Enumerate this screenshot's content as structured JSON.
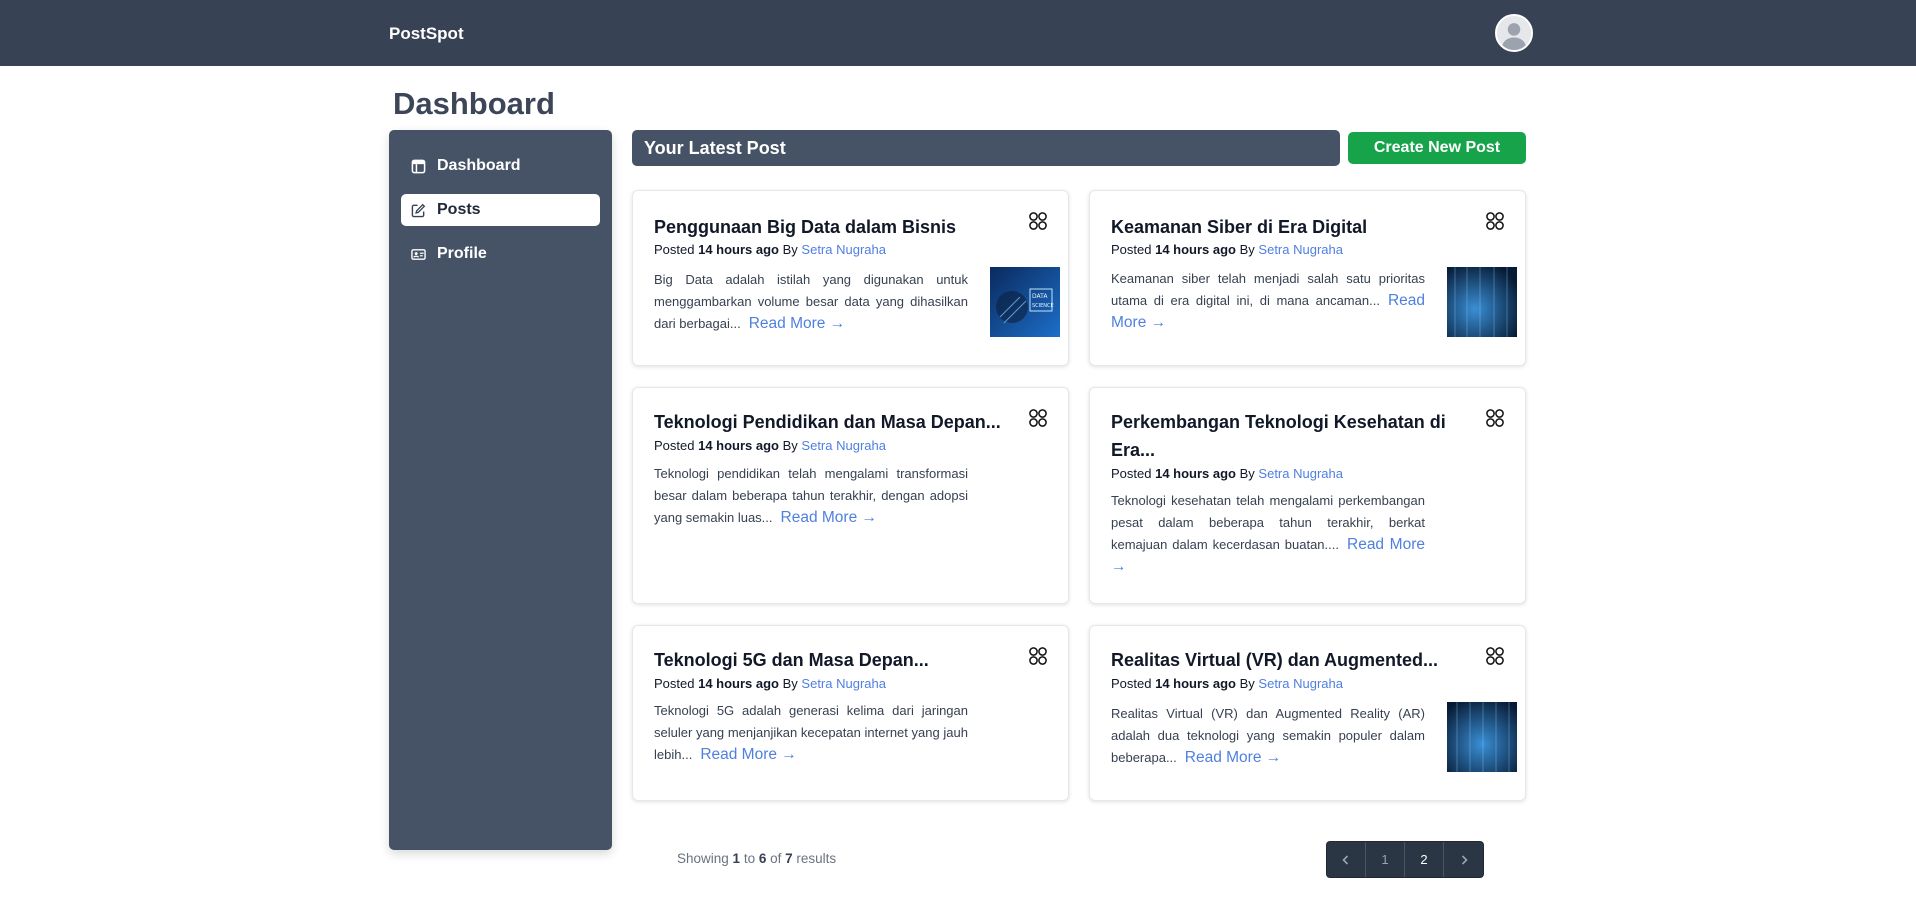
{
  "header": {
    "brand": "PostSpot"
  },
  "page": {
    "title": "Dashboard"
  },
  "sidebar": {
    "items": [
      {
        "label": "Dashboard",
        "icon": "dashboard-icon",
        "active": false
      },
      {
        "label": "Posts",
        "icon": "edit-icon",
        "active": true
      },
      {
        "label": "Profile",
        "icon": "id-card-icon",
        "active": false
      }
    ]
  },
  "latest": {
    "title": "Your Latest Post",
    "create_label": "Create New Post"
  },
  "posts": [
    {
      "title": "Penggunaan Big Data dalam Bisnis",
      "posted_prefix": "Posted ",
      "posted_time": "14 hours ago",
      "by": " By ",
      "author": "Setra Nugraha",
      "excerpt": "Big Data adalah istilah yang digunakan untuk menggambarkan volume besar data yang dihasilkan dari berbagai...",
      "read_more": "Read More →",
      "has_image": true
    },
    {
      "title": "Keamanan Siber di Era Digital",
      "posted_prefix": "Posted ",
      "posted_time": "14 hours ago",
      "by": " By ",
      "author": "Setra Nugraha",
      "excerpt": "Keamanan siber telah menjadi salah satu prioritas utama di era digital ini, di mana ancaman...",
      "read_more": "Read More →",
      "has_image": true
    },
    {
      "title": "Teknologi Pendidikan dan Masa Depan...",
      "posted_prefix": "Posted ",
      "posted_time": "14 hours ago",
      "by": " By ",
      "author": "Setra Nugraha",
      "excerpt": "Teknologi pendidikan telah mengalami transformasi besar dalam beberapa tahun terakhir, dengan adopsi yang semakin luas...",
      "read_more": "Read More →",
      "has_image": false
    },
    {
      "title": "Perkembangan Teknologi Kesehatan di Era...",
      "posted_prefix": "Posted ",
      "posted_time": "14 hours ago",
      "by": " By ",
      "author": "Setra Nugraha",
      "excerpt": "Teknologi kesehatan telah mengalami perkembangan pesat dalam beberapa tahun terakhir, berkat kemajuan dalam kecerdasan buatan....",
      "read_more": "Read More →",
      "has_image": false
    },
    {
      "title": "Teknologi 5G dan Masa Depan...",
      "posted_prefix": "Posted ",
      "posted_time": "14 hours ago",
      "by": " By ",
      "author": "Setra Nugraha",
      "excerpt": "Teknologi 5G adalah generasi kelima dari jaringan seluler yang menjanjikan kecepatan internet yang jauh lebih...",
      "read_more": "Read More →",
      "has_image": false
    },
    {
      "title": "Realitas Virtual (VR) dan Augmented...",
      "posted_prefix": "Posted ",
      "posted_time": "14 hours ago",
      "by": " By ",
      "author": "Setra Nugraha",
      "excerpt": "Realitas Virtual (VR) dan Augmented Reality (AR) adalah dua teknologi yang semakin populer dalam beberapa...",
      "read_more": "Read More →",
      "has_image": true
    }
  ],
  "pagination": {
    "showing": "Showing ",
    "from": "1",
    "to_word": " to ",
    "to": "6",
    "of_word": " of ",
    "total": "7",
    "results_word": " results",
    "pages": [
      "1",
      "2"
    ],
    "current_page": "2"
  },
  "colors": {
    "header_bg": "#374354",
    "sidebar_bg": "#465366",
    "accent_green": "#16a34a",
    "link_blue": "#4f7fe0"
  }
}
